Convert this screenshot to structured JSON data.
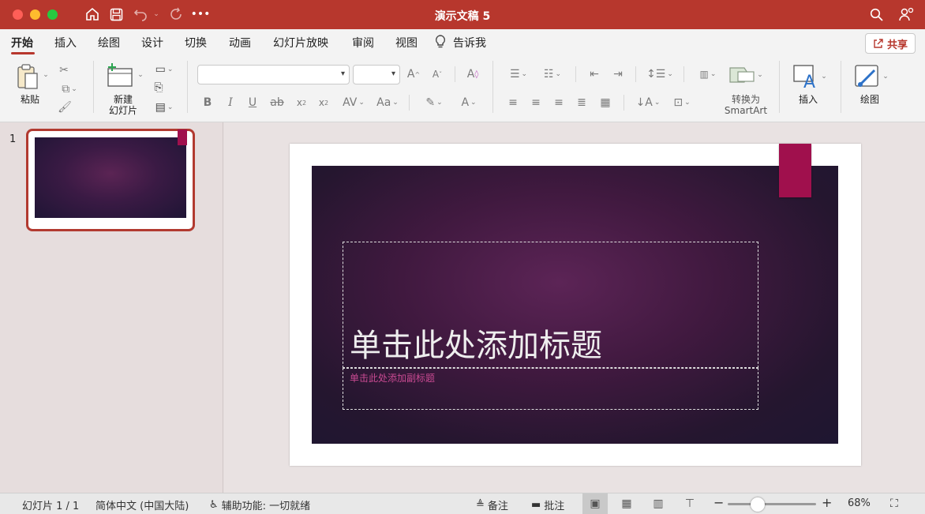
{
  "window": {
    "title": "演示文稿 5"
  },
  "ribbon_tabs": [
    {
      "label": "开始",
      "active": true
    },
    {
      "label": "插入"
    },
    {
      "label": "绘图"
    },
    {
      "label": "设计"
    },
    {
      "label": "切换"
    },
    {
      "label": "动画"
    },
    {
      "label": "幻灯片放映"
    },
    {
      "label": "审阅"
    },
    {
      "label": "视图"
    },
    {
      "label": "告诉我"
    }
  ],
  "share_label": "共享",
  "ribbon": {
    "paste_label": "粘贴",
    "new_slide_label_1": "新建",
    "new_slide_label_2": "幻灯片",
    "convert_label_1": "转换为",
    "convert_label_2": "SmartArt",
    "insert_label": "插入",
    "draw_label": "绘图",
    "font_name_value": "",
    "font_size_value": ""
  },
  "thumbnails": [
    {
      "number": "1"
    }
  ],
  "slide": {
    "title_placeholder": "单击此处添加标题",
    "subtitle_placeholder": "单击此处添加副标题"
  },
  "status_bar": {
    "slide_count": "幻灯片 1 / 1",
    "language": "简体中文 (中国大陆)",
    "accessibility": "辅助功能: 一切就绪",
    "notes_label": "备注",
    "comments_label": "批注",
    "zoom": "68%"
  },
  "colors": {
    "titlebar": "#b7372d",
    "accent_tag": "#a0104d",
    "subtitle_text": "#c94a92"
  }
}
